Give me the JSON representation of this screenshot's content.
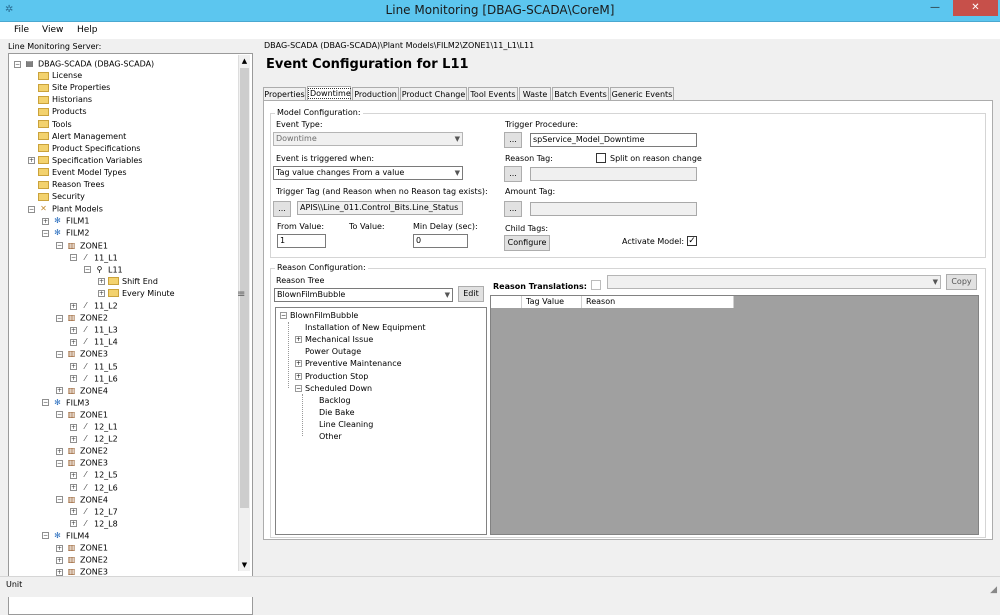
{
  "window": {
    "title": "Line Monitoring [DBAG-SCADA\\CoreM]",
    "min": "—",
    "max": "□",
    "close": "✕"
  },
  "menu": [
    "File",
    "View",
    "Help"
  ],
  "left": {
    "title": "Line Monitoring Server:",
    "tree": [
      {
        "label": "DBAG-SCADA (DBAG-SCADA)",
        "icon": "server",
        "exp": "−",
        "indent": 0
      },
      {
        "label": "License",
        "icon": "folder",
        "indent": 1
      },
      {
        "label": "Site Properties",
        "icon": "folder",
        "indent": 1
      },
      {
        "label": "Historians",
        "icon": "folder",
        "indent": 1
      },
      {
        "label": "Products",
        "icon": "folder",
        "indent": 1
      },
      {
        "label": "Tools",
        "icon": "folder",
        "indent": 1
      },
      {
        "label": "Alert Management",
        "icon": "folder",
        "indent": 1
      },
      {
        "label": "Product Specifications",
        "icon": "folder",
        "indent": 1
      },
      {
        "label": "Specification Variables",
        "icon": "folder",
        "exp": "+",
        "indent": 1
      },
      {
        "label": "Event Model Types",
        "icon": "folder",
        "indent": 1
      },
      {
        "label": "Reason Trees",
        "icon": "folder",
        "indent": 1
      },
      {
        "label": "Security",
        "icon": "folder",
        "indent": 1
      },
      {
        "label": "Plant Models",
        "icon": "pm",
        "exp": "−",
        "indent": 1
      },
      {
        "label": "FILM1",
        "icon": "film",
        "exp": "+",
        "indent": 2
      },
      {
        "label": "FILM2",
        "icon": "film",
        "exp": "−",
        "indent": 2
      },
      {
        "label": "ZONE1",
        "icon": "zone",
        "exp": "−",
        "indent": 3
      },
      {
        "label": "11_L1",
        "icon": "line",
        "exp": "−",
        "indent": 4
      },
      {
        "label": "L11",
        "icon": "key",
        "exp": "−",
        "indent": 5
      },
      {
        "label": "Shift End",
        "icon": "folder",
        "exp": "+",
        "indent": 6
      },
      {
        "label": "Every Minute",
        "icon": "folder",
        "exp": "+",
        "indent": 6
      },
      {
        "label": "11_L2",
        "icon": "line",
        "exp": "+",
        "indent": 4
      },
      {
        "label": "ZONE2",
        "icon": "zone",
        "exp": "−",
        "indent": 3
      },
      {
        "label": "11_L3",
        "icon": "line",
        "exp": "+",
        "indent": 4
      },
      {
        "label": "11_L4",
        "icon": "line",
        "exp": "+",
        "indent": 4
      },
      {
        "label": "ZONE3",
        "icon": "zone",
        "exp": "−",
        "indent": 3
      },
      {
        "label": "11_L5",
        "icon": "line",
        "exp": "+",
        "indent": 4
      },
      {
        "label": "11_L6",
        "icon": "line",
        "exp": "+",
        "indent": 4
      },
      {
        "label": "ZONE4",
        "icon": "zone",
        "exp": "+",
        "indent": 3
      },
      {
        "label": "FILM3",
        "icon": "film",
        "exp": "−",
        "indent": 2
      },
      {
        "label": "ZONE1",
        "icon": "zone",
        "exp": "−",
        "indent": 3
      },
      {
        "label": "12_L1",
        "icon": "line",
        "exp": "+",
        "indent": 4
      },
      {
        "label": "12_L2",
        "icon": "line",
        "exp": "+",
        "indent": 4
      },
      {
        "label": "ZONE2",
        "icon": "zone",
        "exp": "+",
        "indent": 3
      },
      {
        "label": "ZONE3",
        "icon": "zone",
        "exp": "−",
        "indent": 3
      },
      {
        "label": "12_L5",
        "icon": "line",
        "exp": "+",
        "indent": 4
      },
      {
        "label": "12_L6",
        "icon": "line",
        "exp": "+",
        "indent": 4
      },
      {
        "label": "ZONE4",
        "icon": "zone",
        "exp": "−",
        "indent": 3
      },
      {
        "label": "12_L7",
        "icon": "line",
        "exp": "+",
        "indent": 4
      },
      {
        "label": "12_L8",
        "icon": "line",
        "exp": "+",
        "indent": 4
      },
      {
        "label": "FILM4",
        "icon": "film",
        "exp": "−",
        "indent": 2
      },
      {
        "label": "ZONE1",
        "icon": "zone",
        "exp": "+",
        "indent": 3
      },
      {
        "label": "ZONE2",
        "icon": "zone",
        "exp": "+",
        "indent": 3
      },
      {
        "label": "ZONE3",
        "icon": "zone",
        "exp": "+",
        "indent": 3
      }
    ]
  },
  "main": {
    "breadcrumb": "DBAG-SCADA (DBAG-SCADA)\\Plant Models\\FILM2\\ZONE1\\11_L1\\L11",
    "title": "Event Configuration for L11",
    "tabs": [
      "Properties",
      "Downtime",
      "Production",
      "Product Change",
      "Tool Events",
      "Waste",
      "Batch Events",
      "Generic Events"
    ],
    "active_tab": "Downtime",
    "model": {
      "group": "Model Configuration:",
      "event_type_label": "Event Type:",
      "event_type_value": "Downtime",
      "triggered_label": "Event is triggered when:",
      "triggered_value": "Tag value changes From a value",
      "trigger_tag_label": "Trigger Tag (and Reason when no Reason tag exists):",
      "trigger_tag_value": "APIS\\\\Line_011.Control_Bits.Line_Status",
      "from_label": "From Value:",
      "from_value": "1",
      "to_label": "To Value:",
      "delay_label": "Min Delay (sec):",
      "delay_value": "0",
      "proc_label": "Trigger Procedure:",
      "proc_value": "spService_Model_Downtime",
      "reason_tag_label": "Reason Tag:",
      "split_label": "Split on reason change",
      "amount_label": "Amount Tag:",
      "child_label": "Child Tags:",
      "configure": "Configure",
      "activate_label": "Activate Model:",
      "browse": "...",
      "check": "✓"
    },
    "reason": {
      "group": "Reason Configuration:",
      "tree_label": "Reason Tree",
      "tree_value": "BlownFilmBubble",
      "edit": "Edit",
      "translations_label": "Reason Translations:",
      "copy": "Copy",
      "col_tag": "Tag Value",
      "col_reason": "Reason",
      "nodes": [
        {
          "label": "BlownFilmBubble",
          "exp": "−",
          "lvl": 0
        },
        {
          "label": "Installation of New Equipment",
          "lvl": 1
        },
        {
          "label": "Mechanical Issue",
          "exp": "+",
          "lvl": 1
        },
        {
          "label": "Power Outage",
          "lvl": 1
        },
        {
          "label": "Preventive Maintenance",
          "exp": "+",
          "lvl": 1
        },
        {
          "label": "Production Stop",
          "exp": "+",
          "lvl": 1
        },
        {
          "label": "Scheduled Down",
          "exp": "−",
          "lvl": 1
        },
        {
          "label": "Backlog",
          "lvl": 2
        },
        {
          "label": "Die Bake",
          "lvl": 2
        },
        {
          "label": "Line Cleaning",
          "lvl": 2
        },
        {
          "label": "Other",
          "lvl": 2
        }
      ]
    }
  },
  "status": "Unit"
}
